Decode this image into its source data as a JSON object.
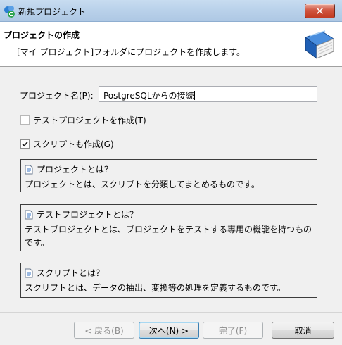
{
  "window": {
    "title": "新規プロジェクト",
    "close_label": "✕"
  },
  "header": {
    "title": "プロジェクトの作成",
    "subtitle": "[マイ プロジェクト]フォルダにプロジェクトを作成します。"
  },
  "form": {
    "name_label": "プロジェクト名(P):",
    "name_value": "PostgreSQLからの接続",
    "test_project_label": "テストプロジェクトを作成(T)",
    "test_project_checked": false,
    "script_label": "スクリプトも作成(G)",
    "script_checked": true
  },
  "info": [
    {
      "title": "プロジェクトとは？",
      "body": "プロジェクトとは、スクリプトを分類してまとめるものです。"
    },
    {
      "title": "テストプロジェクトとは？",
      "body": "テストプロジェクトとは、プロジェクトをテストする専用の機能を持つものです。"
    },
    {
      "title": "スクリプトとは？",
      "body": "スクリプトとは、データの抽出、変換等の処理を定義するものです。"
    }
  ],
  "buttons": {
    "back": "< 戻る(B)",
    "next": "次へ(N) >",
    "finish": "完了(F)",
    "cancel": "取消"
  },
  "colors": {
    "title_bar": "#b9d1ea",
    "close_button": "#c23b22",
    "book_icon": "#2c6cc4"
  }
}
